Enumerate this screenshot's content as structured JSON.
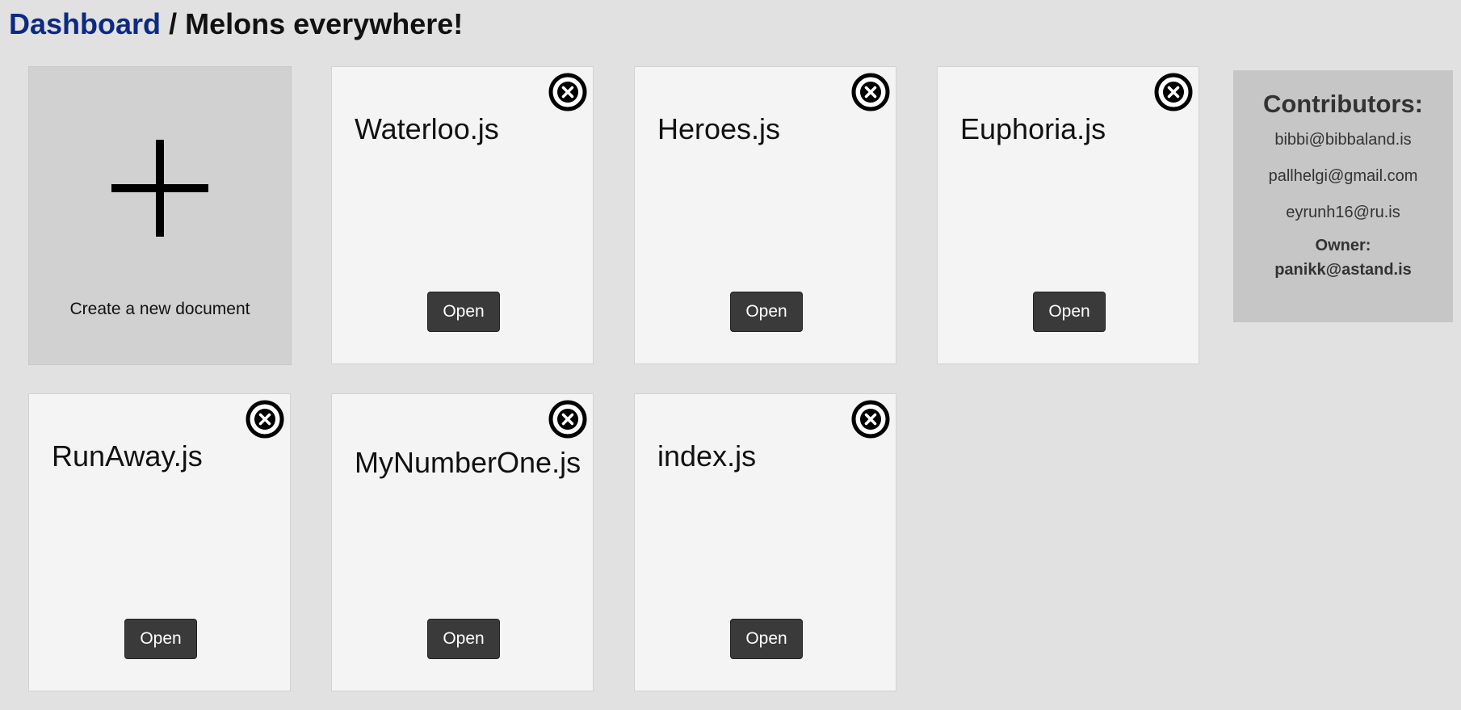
{
  "breadcrumb": {
    "root": "Dashboard",
    "separator": "/",
    "current": "Melons everywhere!"
  },
  "create_card": {
    "label": "Create a new document",
    "icon": "plus-icon"
  },
  "documents": [
    {
      "name": "Waterloo.js",
      "open_label": "Open",
      "close_icon": "close-circle-icon"
    },
    {
      "name": "Heroes.js",
      "open_label": "Open",
      "close_icon": "close-circle-icon"
    },
    {
      "name": "Euphoria.js",
      "open_label": "Open",
      "close_icon": "close-circle-icon"
    },
    {
      "name": "RunAway.js",
      "open_label": "Open",
      "close_icon": "close-circle-icon"
    },
    {
      "name": "MyNumberOne.js",
      "open_label": "Open",
      "close_icon": "close-circle-icon"
    },
    {
      "name": "index.js",
      "open_label": "Open",
      "close_icon": "close-circle-icon"
    }
  ],
  "contributors": {
    "title": "Contributors:",
    "emails": [
      "bibbi@bibbaland.is",
      "pallhelgi@gmail.com",
      "eyrunh16@ru.is"
    ],
    "owner_label": "Owner:",
    "owner_email": "panikk@astand.is"
  },
  "colors": {
    "background": "#e1e1e1",
    "card": "#f4f4f4",
    "create_card": "#d1d1d1",
    "contributors_panel": "#c6c6c6",
    "button": "#3a3a3a",
    "link": "#0c2a82"
  }
}
